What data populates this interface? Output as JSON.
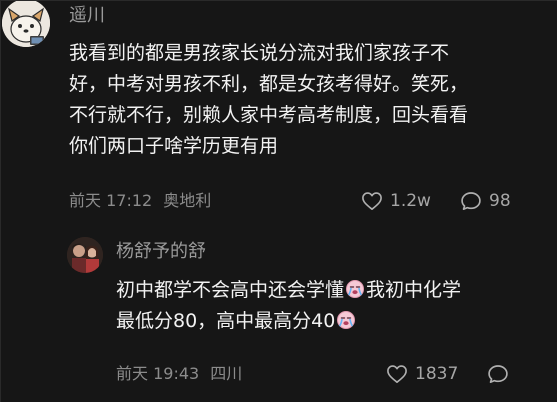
{
  "comment": {
    "username": "遥川",
    "text_lines": [
      "我看到的都是男孩家长说分流对我们家孩子不",
      "好，中考对男孩不利，都是女孩考得好。笑死，",
      "不行就不行，别赖人家中考高考制度，回头看看",
      "你们两口子啥学历更有用"
    ],
    "time": "前天 17:12",
    "location": "奥地利",
    "likes": "1.2w",
    "replies": "98",
    "avatar_icon": "cartoon-dog-avatar"
  },
  "reply": {
    "username": "杨舒予的舒",
    "line1_text": "初中都学不会高中还会学懂",
    "line1_after": "我初中化学",
    "line2_text": "最低分80，高中最高分40",
    "emoji_icon": "crying-face-emoji",
    "time": "前天 19:43",
    "location": "四川",
    "likes": "1837",
    "avatar_icon": "couple-photo-avatar"
  },
  "colors": {
    "background": "#161616",
    "primary_text": "#f2f2f2",
    "secondary_text": "#8c8c8c",
    "emoji_face": "#f5c9d6"
  }
}
